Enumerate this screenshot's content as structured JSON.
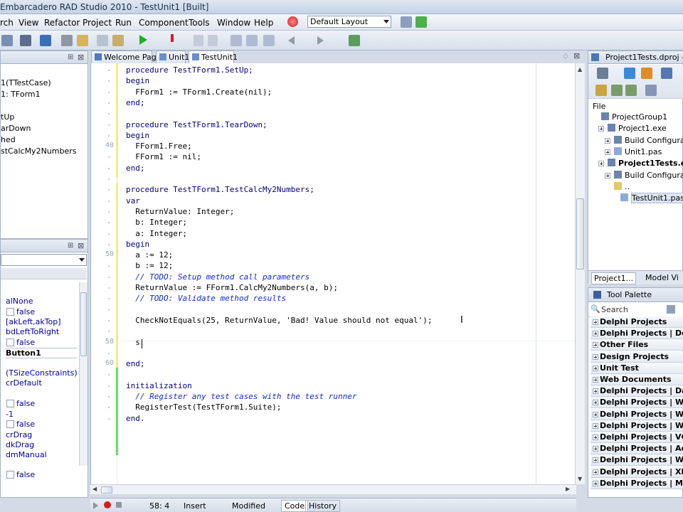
{
  "window": {
    "title": "Embarcadero RAD Studio 2010 - TestUnit1 [Built]"
  },
  "menu": [
    "rch",
    "View",
    "Refactor",
    "Project",
    "Run",
    "Component",
    "Tools",
    "Window",
    "Help"
  ],
  "layout_combo": "Default Layout",
  "tabs": [
    "Welcome Page",
    "Unit1",
    "TestUnit1"
  ],
  "structure": {
    "items": [
      "1(TTestCase)",
      "1: TForm1",
      "tUp",
      "arDown",
      "hed",
      "stCalcMy2Numbers"
    ]
  },
  "object_inspector": {
    "rows": [
      {
        "text": "alNone",
        "check": false
      },
      {
        "text": "false",
        "check": true
      },
      {
        "text": "[akLeft,akTop]",
        "check": false
      },
      {
        "text": "bdLeftToRight",
        "check": false
      },
      {
        "text": "false",
        "check": true
      },
      {
        "text": "Button1",
        "check": false,
        "bold": true
      },
      {
        "text": "(TSizeConstraints)",
        "check": false
      },
      {
        "text": "crDefault",
        "check": false
      },
      {
        "text": "false",
        "check": true
      },
      {
        "text": "-1",
        "check": false
      },
      {
        "text": "false",
        "check": true
      },
      {
        "text": "crDrag",
        "check": false
      },
      {
        "text": "dkDrag",
        "check": false
      },
      {
        "text": "dmManual",
        "check": false
      },
      {
        "text": "false",
        "check": true
      }
    ]
  },
  "editor": {
    "line_numbers": {
      "l40": "40",
      "l50": "50",
      "l58": "58",
      "l60": "60"
    },
    "lines": [
      "procedure TestTForm1.SetUp;",
      "begin",
      "  FForm1 := TForm1.Create(nil);",
      "end;",
      "",
      "procedure TestTForm1.TearDown;",
      "begin",
      "  FForm1.Free;",
      "  FForm1 := nil;",
      "end;",
      "",
      "procedure TestTForm1.TestCalcMy2Numbers;",
      "var",
      "  ReturnValue: Integer;",
      "  b: Integer;",
      "  a: Integer;",
      "begin",
      "  a := 12;",
      "  b := 12;",
      "  // TODO: Setup method call parameters",
      "  ReturnValue := FForm1.CalcMy2Numbers(a, b);",
      "  // TODO: Validate method results",
      "",
      "  CheckNotEquals(25, ReturnValue, 'Bad! Value should not equal');",
      "",
      "  s",
      "",
      "end;",
      "",
      "initialization",
      "  // Register any test cases with the test runner",
      "  RegisterTest(TestTForm1.Suite);",
      "end."
    ]
  },
  "project_manager": {
    "header": "Project1Tests.dproj - Pro",
    "file_label": "File",
    "tree": [
      {
        "label": "ProjectGroup1",
        "indent": 0,
        "bold": false
      },
      {
        "label": "Project1.exe",
        "indent": 1,
        "bold": false
      },
      {
        "label": "Build Configuration",
        "indent": 2,
        "bold": false
      },
      {
        "label": "Unit1.pas",
        "indent": 2,
        "bold": false
      },
      {
        "label": "Project1Tests.exe",
        "indent": 1,
        "bold": true
      },
      {
        "label": "Build Configuration",
        "indent": 2,
        "bold": false
      },
      {
        "label": "..",
        "indent": 2,
        "bold": false
      },
      {
        "label": "TestUnit1.pas",
        "indent": 3,
        "bold": false
      }
    ],
    "bottom_tabs": [
      "Project1...",
      "Model Vi"
    ]
  },
  "tool_palette": {
    "title": "Tool Palette",
    "search_placeholder": "Search",
    "categories": [
      "Delphi Projects",
      "Delphi Projects | Delph",
      "Other Files",
      "Design Projects",
      "Unit Test",
      "Web Documents",
      "Delphi Projects | DataS",
      "Delphi Projects | WebS",
      "Delphi Projects | WebS",
      "Delphi Projects | WebB",
      "Delphi Projects | VCL fo",
      "Delphi Projects | Active",
      "Delphi Projects | Wizar",
      "Delphi Projects | XML",
      "Delphi Projects | Multi"
    ]
  },
  "status": {
    "position": "58:  4",
    "mode": "Insert",
    "state": "Modified",
    "tab_code": "Code",
    "tab_history": "History"
  }
}
